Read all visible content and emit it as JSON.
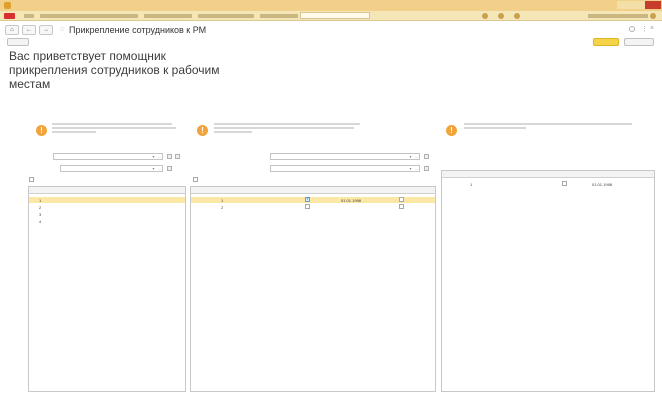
{
  "window": {
    "title": ""
  },
  "toolbar": {
    "back_label": "←",
    "forward_label": "→",
    "page_title": "Прикрепление сотрудников к РМ",
    "more_label": "⋮"
  },
  "actions": {
    "small_button_label": "",
    "primary_button_label": "",
    "secondary_button_label": ""
  },
  "welcome": {
    "heading": "Вас приветствует помощник прикрепления сотрудников к рабочим местам"
  },
  "left": {
    "organization_label": "",
    "organization_value": "",
    "subdivision_label": "",
    "subdivision_value": "",
    "checkbox_label": "",
    "columns": [
      "",
      "",
      ""
    ],
    "rows": [
      {
        "n": "1",
        "name": "",
        "position": ""
      },
      {
        "n": "2",
        "name": "",
        "position": ""
      },
      {
        "n": "3",
        "name": "",
        "position": ""
      },
      {
        "n": "4",
        "name": "",
        "position": ""
      }
    ]
  },
  "middle": {
    "subdivision_label": "",
    "subdivision_value": "",
    "position_label": "",
    "position_value": "",
    "checkbox_label": "",
    "columns": [
      "",
      "",
      "",
      "",
      ""
    ],
    "rows": [
      {
        "n": "1",
        "workplace": "",
        "attached": true,
        "date": "01.01.1998",
        "main": false
      },
      {
        "n": "2",
        "workplace": "",
        "attached": false,
        "date": "",
        "main": false
      }
    ]
  },
  "right": {
    "columns": [
      "",
      "",
      "",
      ""
    ],
    "rows": [
      {
        "n": "1",
        "workplace": "",
        "attached": false,
        "date": "01.01.1998"
      }
    ]
  },
  "colors": {
    "accent": "#f6d44a",
    "titlebar": "#f2d08a",
    "selected_row": "#fbe7a6",
    "info": "#f2a33a"
  }
}
